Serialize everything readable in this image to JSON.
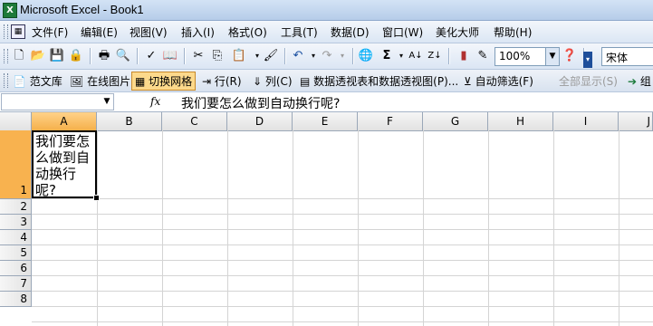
{
  "window": {
    "title": "Microsoft Excel - Book1",
    "app_icon": "excel-icon"
  },
  "menu": [
    "文件(F)",
    "编辑(E)",
    "视图(V)",
    "插入(I)",
    "格式(O)",
    "工具(T)",
    "数据(D)",
    "窗口(W)",
    "美化大师",
    "帮助(H)"
  ],
  "toolbar": {
    "zoom": "100%",
    "font": "宋体",
    "icons": [
      "new-icon",
      "open-icon",
      "save-icon",
      "permission-icon",
      "print-icon",
      "print-preview-icon",
      "spelling-icon",
      "research-icon",
      "cut-icon",
      "copy-icon",
      "paste-icon",
      "format-painter-icon",
      "undo-icon",
      "redo-icon",
      "hyperlink-icon",
      "autosum-icon",
      "sort-ascending-icon",
      "sort-descending-icon",
      "chart-wizard-icon",
      "drawing-icon",
      "help-icon"
    ],
    "autosum_glyph": "Σ"
  },
  "toolbar2": {
    "items": [
      "范文库",
      "在线图片",
      "切换网格",
      "行(R)",
      "列(C)",
      "数据透视表和数据透视图(P)...",
      "自动筛选(F)",
      "全部显示(S)",
      "组"
    ],
    "active": "切换网格"
  },
  "formula_bar": {
    "name_box": "",
    "fx": "fx",
    "content": "我们要怎么做到自动换行呢?"
  },
  "grid": {
    "columns": [
      "A",
      "B",
      "C",
      "D",
      "E",
      "F",
      "G",
      "H",
      "I",
      "J"
    ],
    "rows": [
      "1",
      "2",
      "3",
      "4",
      "5",
      "6",
      "7",
      "8"
    ],
    "selected_column": "A",
    "selected_row": "1",
    "cell_a1": "我们要怎么做到自动换行呢?"
  },
  "colors": {
    "selection_header": "#f8b24f",
    "toolbar": "#dbe6f4",
    "active_button": "#fcd98b"
  }
}
